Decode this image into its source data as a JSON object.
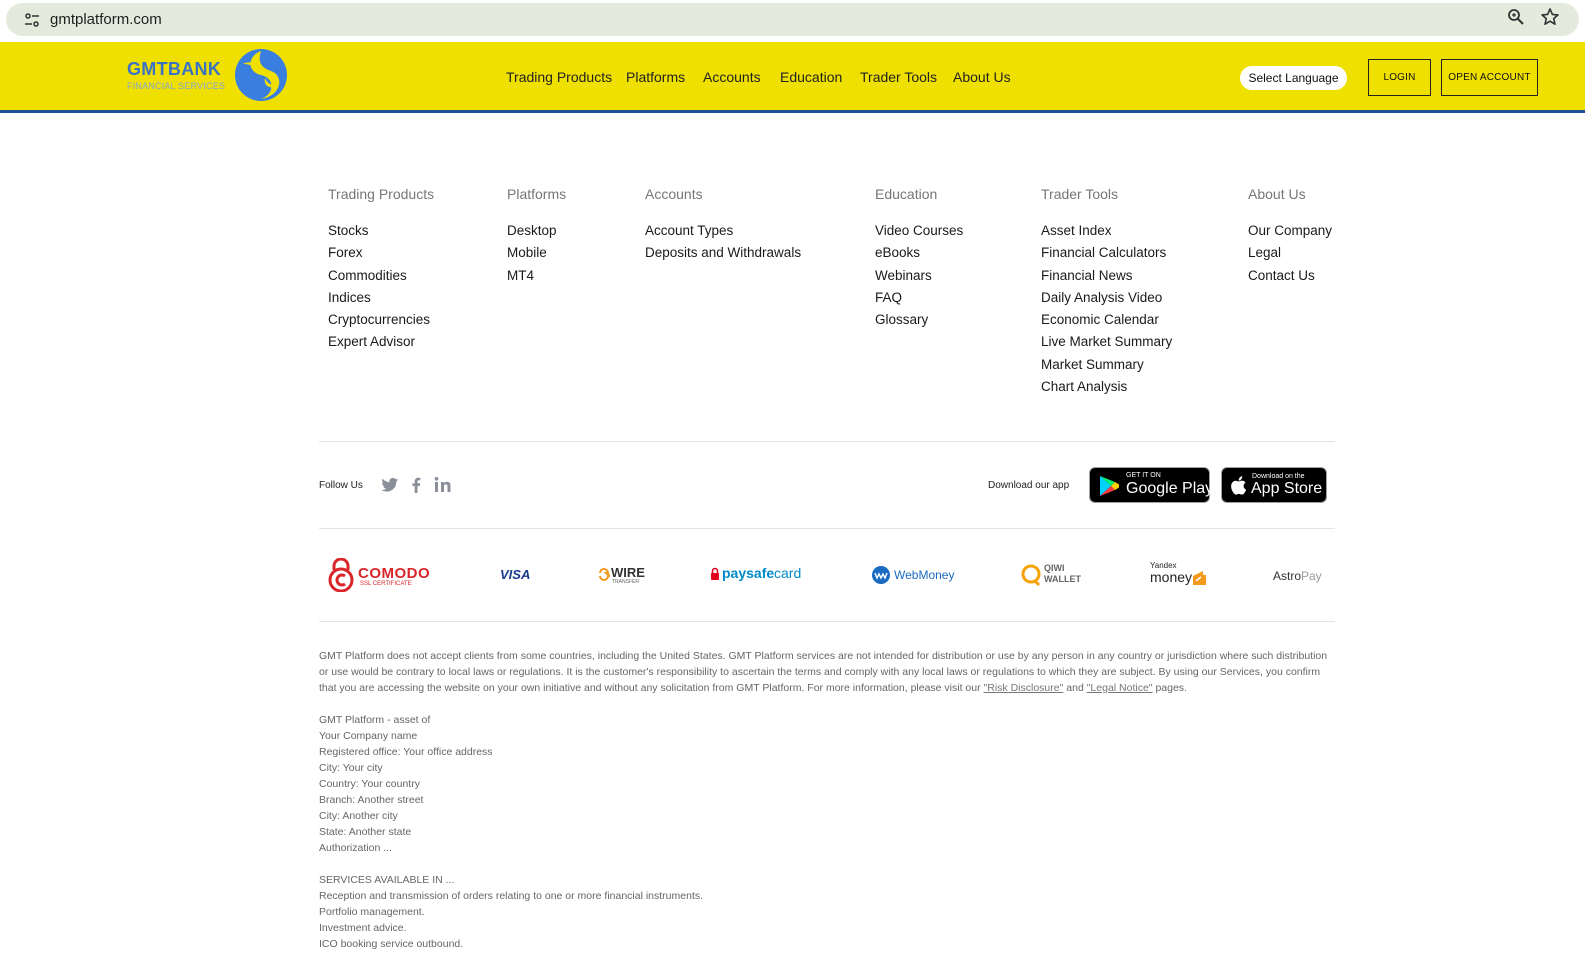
{
  "browser": {
    "url": "gmtplatform.com"
  },
  "header": {
    "logo_name": "GMTBANK",
    "logo_sub": "FINANCIAL SERVICES",
    "nav": [
      "Trading Products",
      "Platforms",
      "Accounts",
      "Education",
      "Trader Tools",
      "About Us"
    ],
    "language_label": "Select Language",
    "login_label": "LOGIN",
    "open_account_label": "OPEN ACCOUNT"
  },
  "footer_menu": [
    {
      "title": "Trading Products",
      "links": [
        "Stocks",
        "Forex",
        "Commodities",
        "Indices",
        "Cryptocurrencies",
        "Expert Advisor"
      ]
    },
    {
      "title": "Platforms",
      "links": [
        "Desktop",
        "Mobile",
        "MT4"
      ]
    },
    {
      "title": "Accounts",
      "links": [
        "Account Types",
        "Deposits and Withdrawals"
      ]
    },
    {
      "title": "Education",
      "links": [
        "Video Courses",
        "eBooks",
        "Webinars",
        "FAQ",
        "Glossary"
      ]
    },
    {
      "title": "Trader Tools",
      "links": [
        "Asset Index",
        "Financial Calculators",
        "Financial News",
        "Daily Analysis Video",
        "Economic Calendar",
        "Live Market Summary",
        "Market Summary",
        "Chart Analysis"
      ]
    },
    {
      "title": "About Us",
      "links": [
        "Our Company",
        "Legal",
        "Contact Us"
      ]
    }
  ],
  "social": {
    "follow_label": "Follow Us",
    "icons": [
      "twitter-icon",
      "facebook-icon",
      "linkedin-icon"
    ]
  },
  "apps": {
    "download_label": "Download our app",
    "google_small": "GET IT ON",
    "google_big": "Google Play",
    "apple_small": "Download on the",
    "apple_big": "App Store"
  },
  "payments": {
    "comodo": "COMODO",
    "comodo_sub": "SSL CERTIFICATE",
    "visa": "VISA",
    "wire": "WIRE",
    "wire_sub": "TRANSFER",
    "paysafe_a": "paysafe",
    "paysafe_b": "card",
    "webmoney": "WebMoney",
    "qiwi_a": "QIWI",
    "qiwi_b": "WALLET",
    "yandex_a": "Yandex",
    "yandex_b": "money",
    "astropay_a": "Astro",
    "astropay_b": "Pay"
  },
  "disclaimer": {
    "text": "GMT Platform does not accept clients from some countries, including the United States. GMT Platform services are not intended for distribution or use by any person in any country or jurisdiction where such distribution or use would be contrary to local laws or regulations. It is the customer's responsibility to ascertain the terms and comply with any local laws or regulations to which they are subject. By using our Services, you confirm that you are accessing the website on your own initiative and without any solicitation from GMT Platform. For more information, please visit our ",
    "link1": "\"Risk Disclosure\"",
    "mid": " and ",
    "link2": "\"Legal Notice\"",
    "end": " pages."
  },
  "company_info": [
    "GMT Platform - asset of",
    "Your Company name",
    "Registered office: Your office address",
    "City: Your city",
    "Country: Your country",
    "Branch: Another street",
    "City: Another city",
    "State: Another state",
    "Authorization ..."
  ],
  "services": [
    "SERVICES AVAILABLE IN ...",
    "Reception and transmission of orders relating to one or more financial instruments.",
    "Portfolio management.",
    "Investment advice.",
    "ICO booking service outbound."
  ],
  "colors": {
    "header_bg": "#efe000",
    "header_border": "#1f4f99",
    "brand_blue": "#3a72c6"
  }
}
